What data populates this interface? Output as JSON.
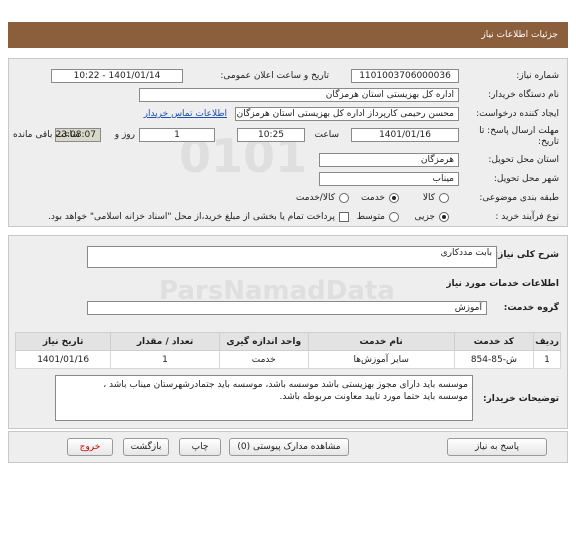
{
  "page_title": "جزئیات اطلاعات نیاز",
  "info": {
    "need_number_label": "شماره نیاز:",
    "need_number": "1101003706000036",
    "announce_label": "تاریخ و ساعت اعلان عمومی:",
    "announce_value": "1401/01/14 - 10:22",
    "buyer_label": "نام دستگاه خریدار:",
    "buyer_value": "اداره کل بهزیستی استان هرمزگان",
    "creator_label": "ایجاد کننده درخواست:",
    "creator_value": "محسن  رحیمی  کارپرداز اداره کل بهزیستی استان هرمزگان",
    "contact_link": "اطلاعات تماس خریدار",
    "deadline_label": "مهلت ارسال پاسخ: تا",
    "deadline_label2": "تاریخ:",
    "deadline_date": "1401/01/16",
    "time_label": "ساعت",
    "deadline_time": "10:25",
    "days_value": "1",
    "days_label": "روز و",
    "remaining_time": "23:08:07",
    "remaining_label": "ساعت باقی مانده",
    "province_label": "استان محل تحویل:",
    "province_value": "هرمزگان",
    "city_label": "شهر محل تحویل:",
    "city_value": "میناب",
    "category_label": "طبقه بندی موضوعی:",
    "category_options": [
      "کالا",
      "خدمت",
      "کالا/خدمت"
    ],
    "category_selected": "خدمت",
    "process_label": "نوع فرآیند خرید :",
    "process_options": [
      "جزیی",
      "متوسط"
    ],
    "process_selected": "جزیی",
    "payment_note": "پرداخت تمام یا بخشی از مبلغ خرید،از محل \"اسناد خزانه اسلامی\" خواهد بود."
  },
  "details": {
    "summary_label": "شرح کلی نیاز:",
    "summary_value": "بابت مددکاری",
    "services_heading": "اطلاعات خدمات مورد نیاز",
    "group_label": "گروه خدمت:",
    "group_value": "آموزش",
    "table_headers": [
      "ردیف",
      "کد خدمت",
      "نام خدمت",
      "واحد اندازه گیری",
      "تعداد / مقدار",
      "تاریخ نیاز"
    ],
    "table_rows": [
      [
        "1",
        "ش-85-854",
        "سایر آموزش‌ها",
        "خدمت",
        "1",
        "1401/01/16"
      ]
    ],
    "buyer_notes_label": "توضیحات خریدار:",
    "buyer_notes_line1": "موسسه باید دارای مجوز بهزیستی باشد موسسه باشد، موسسه باید جتمادرشهرستان میناب باشد ،",
    "buyer_notes_line2": "موسسه باید حتما مورد تایید معاونت مربوطه باشد."
  },
  "buttons": {
    "reply": "پاسخ به نیاز",
    "view_docs": "مشاهده مدارک پیوستی (0)",
    "print": "چاپ",
    "back": "بازگشت",
    "exit": "خروج"
  },
  "colors": {
    "title_bar": "#8b5e3c",
    "exit_button_text": "#cc0000",
    "link": "#1e50b4"
  }
}
